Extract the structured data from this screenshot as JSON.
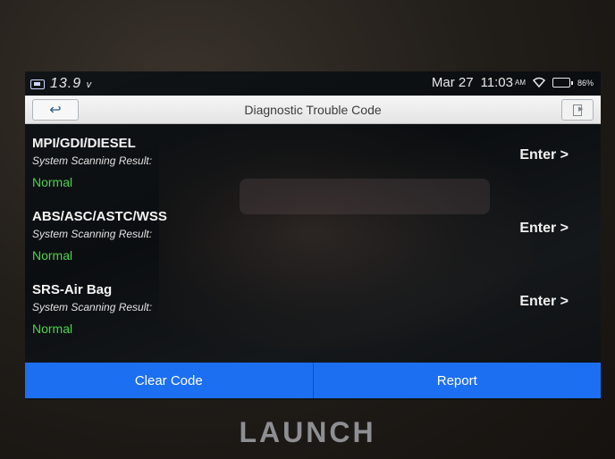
{
  "statusbar": {
    "voltage": "13.9",
    "voltage_unit": "v",
    "date": "Mar 27",
    "time": "11:03",
    "ampm": "AM",
    "battery": "86%",
    "icons": [
      "car-battery-icon",
      "wifi-icon",
      "battery-icon"
    ]
  },
  "titlebar": {
    "back_icon": "↩",
    "title": "Diagnostic Trouble Code",
    "exit_icon": "exit-icon"
  },
  "systems": [
    {
      "name": "MPI/GDI/DIESEL",
      "label": "System Scanning Result:",
      "status": "Normal",
      "enter": "Enter >"
    },
    {
      "name": "ABS/ASC/ASTC/WSS",
      "label": "System Scanning Result:",
      "status": "Normal",
      "enter": "Enter >"
    },
    {
      "name": "SRS-Air Bag",
      "label": "System Scanning Result:",
      "status": "Normal",
      "enter": "Enter >"
    }
  ],
  "actions": {
    "clear_code": "Clear Code",
    "report": "Report"
  },
  "brand": "LAUNCH",
  "colors": {
    "accent_blue": "#1c6ff0",
    "status_green": "#4bd44b",
    "titlebar_bg": "#eeeeee"
  }
}
